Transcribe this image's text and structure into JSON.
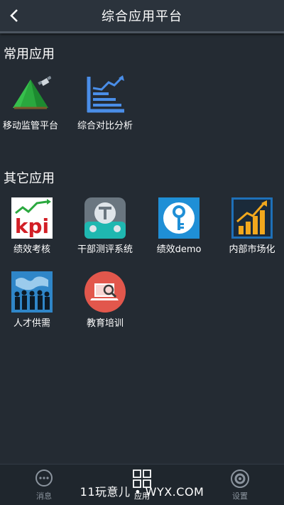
{
  "header": {
    "title": "综合应用平台"
  },
  "sections": {
    "common": {
      "title": "常用应用",
      "apps": [
        {
          "label": "移动监管平台",
          "icon": "green-triangle-satellite-icon"
        },
        {
          "label": "综合对比分析",
          "icon": "trend-chart-icon"
        }
      ]
    },
    "other": {
      "title": "其它应用",
      "apps": [
        {
          "label": "绩效考核",
          "icon": "kpi-icon"
        },
        {
          "label": "干部测评系统",
          "icon": "t-gauge-icon"
        },
        {
          "label": "绩效demo",
          "icon": "key-icon"
        },
        {
          "label": "内部市场化",
          "icon": "bar-growth-icon"
        },
        {
          "label": "人才供需",
          "icon": "people-world-icon"
        },
        {
          "label": "教育培训",
          "icon": "laptop-search-icon"
        }
      ]
    }
  },
  "tabbar": {
    "items": [
      {
        "label": "消息",
        "icon": "chat-bubble-icon"
      },
      {
        "label": "应用",
        "icon": "grid-icon"
      },
      {
        "label": "设置",
        "icon": "gear-icon"
      }
    ]
  },
  "watermark": {
    "text": "11玩意儿 • WYX.COM"
  },
  "colors": {
    "background": "#242b33",
    "header": "#2b333c",
    "tabbar": "#1f262d"
  }
}
